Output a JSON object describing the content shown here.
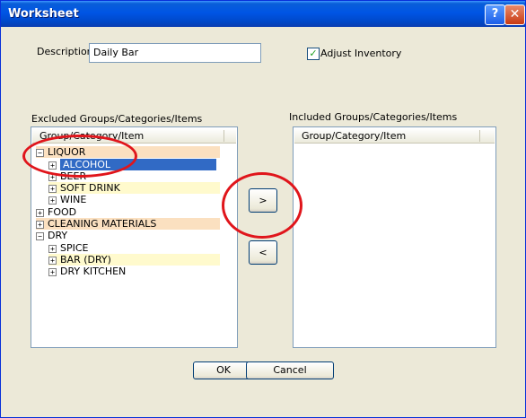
{
  "window": {
    "title": "Worksheet",
    "help": "?",
    "close": "✕"
  },
  "description": {
    "label": "Description",
    "value": "Daily Bar"
  },
  "adjust_inventory": {
    "label": "Adjust Inventory",
    "checked": true,
    "mark": "✓"
  },
  "excluded": {
    "label": "Excluded Groups/Categories/Items",
    "column": "Group/Category/Item",
    "rows": [
      {
        "label": "LIQUOR",
        "sign": "−"
      },
      {
        "label": "ALCOHOL",
        "sign": "+"
      },
      {
        "label": "BEER",
        "sign": "+"
      },
      {
        "label": "SOFT DRINK",
        "sign": "+"
      },
      {
        "label": "WINE",
        "sign": "+"
      },
      {
        "label": "FOOD",
        "sign": "+"
      },
      {
        "label": "CLEANING MATERIALS",
        "sign": "+"
      },
      {
        "label": "DRY",
        "sign": "−"
      },
      {
        "label": "SPICE",
        "sign": "+"
      },
      {
        "label": "BAR (DRY)",
        "sign": "+"
      },
      {
        "label": "DRY KITCHEN",
        "sign": "+"
      }
    ]
  },
  "included": {
    "label": "Included Groups/Categories/Items",
    "column": "Group/Category/Item"
  },
  "buttons": {
    "add": ">",
    "remove": "<",
    "ok": "OK",
    "cancel": "Cancel"
  }
}
